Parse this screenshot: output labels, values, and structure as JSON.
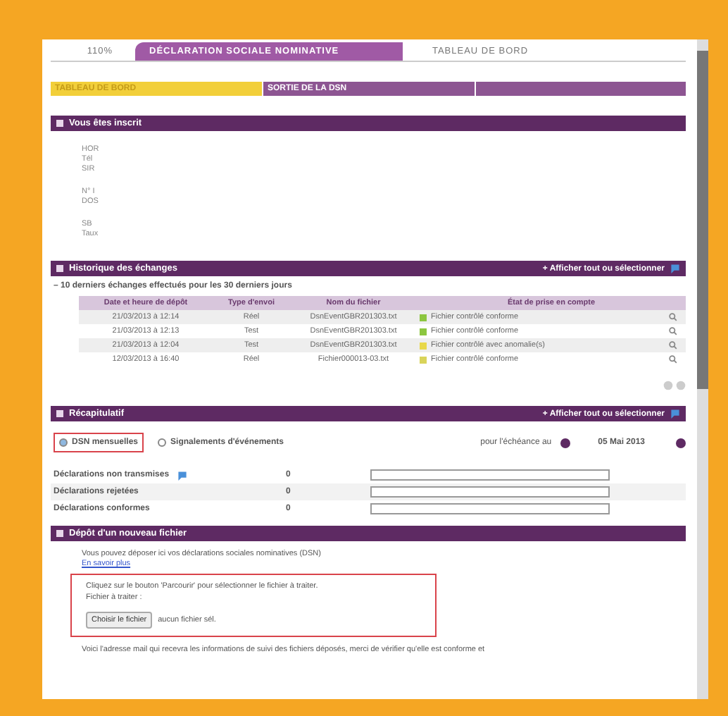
{
  "top_tabs": [
    {
      "label": "110%",
      "selected": false
    },
    {
      "label": "DÉCLARATION SOCIALE NOMINATIVE",
      "selected": true
    },
    {
      "label": "TABLEAU DE BORD",
      "selected": false
    }
  ],
  "nav": [
    {
      "label": "TABLEAU DE BORD",
      "selected": true
    },
    {
      "label": "SORTIE DE LA DSN",
      "selected": false
    }
  ],
  "registration": {
    "title": "Vous êtes inscrit",
    "groups": [
      [
        "HOR",
        "Tél",
        "SIR"
      ],
      [
        "N° I",
        "DOS"
      ],
      [
        "SB",
        "Taux"
      ]
    ]
  },
  "history": {
    "title": "Historique des échanges",
    "action": "+ Afficher tout ou sélectionner",
    "subtitle": "– 10 derniers échanges effectués pour les 30 derniers jours",
    "columns": [
      "Date et heure de dépôt",
      "Type d'envoi",
      "Nom du fichier",
      "État de prise en compte"
    ],
    "rows": [
      {
        "date": "21/03/2013 à 12:14",
        "type": "Réel",
        "file": "DsnEventGBR201303.txt",
        "status": "Fichier contrôlé conforme",
        "color": "#8cc63f"
      },
      {
        "date": "21/03/2013 à 12:13",
        "type": "Test",
        "file": "DsnEventGBR201303.txt",
        "status": "Fichier contrôlé conforme",
        "color": "#8cc63f"
      },
      {
        "date": "21/03/2013 à 12:04",
        "type": "Test",
        "file": "DsnEventGBR201303.txt",
        "status": "Fichier contrôlé avec anomalie(s)",
        "color": "#e8d84a"
      },
      {
        "date": "12/03/2013 à 16:40",
        "type": "Réel",
        "file": "Fichier000013-03.txt",
        "status": "Fichier contrôlé conforme",
        "color": "#d9d45a"
      }
    ]
  },
  "summary": {
    "title": "Récapitulatif",
    "action": "+ Afficher tout ou sélectionner",
    "options": [
      {
        "label": "DSN mensuelles",
        "selected": true
      },
      {
        "label": "Signalements d'événements",
        "selected": false
      }
    ],
    "due_label": "pour l'échéance au",
    "due_date": "05 Mai 2013",
    "rows": [
      {
        "label": "Déclarations non transmises",
        "info": true,
        "count": "0"
      },
      {
        "label": "Déclarations rejetées",
        "info": false,
        "count": "0"
      },
      {
        "label": "Déclarations conformes",
        "info": false,
        "count": "0"
      }
    ]
  },
  "upload": {
    "title": "Dépôt d'un nouveau fichier",
    "intro": "Vous pouvez déposer ici vos déclarations sociales nominatives (DSN)",
    "link": "En savoir plus",
    "instruction": "Cliquez sur le bouton 'Parcourir' pour sélectionner le fichier à traiter.",
    "file_label": "Fichier à traiter :",
    "button": "Choisir le fichier",
    "no_file": "aucun fichier sél.",
    "footer": "Voici l'adresse mail qui recevra les informations de suivi des fichiers déposés, merci de vérifier qu'elle est conforme et"
  }
}
